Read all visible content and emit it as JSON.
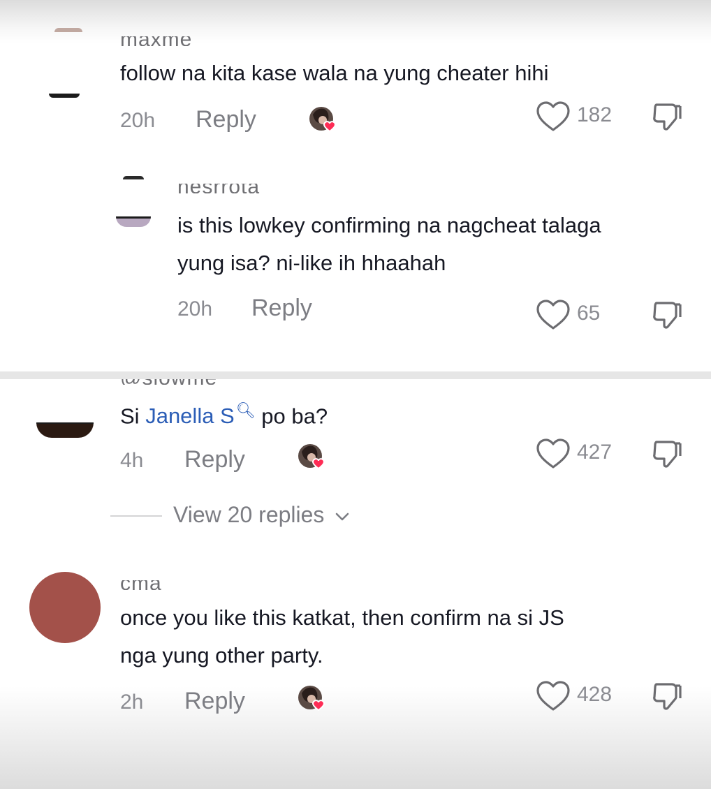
{
  "comments": [
    {
      "username": "maxme",
      "text": "follow na kita kase wala na yung cheater hihi",
      "time": "20h",
      "reply_label": "Reply",
      "likes": "182",
      "liked_by_creator": true
    },
    {
      "username": "nesrrota",
      "text_line1": "is this lowkey confirming na nagcheat talaga",
      "text_line2": "yung isa? ni-like ih hhaahah",
      "time": "20h",
      "reply_label": "Reply",
      "likes": "65",
      "liked_by_creator": false
    },
    {
      "username": "@slowme",
      "text_before": "Si",
      "mention": "Janella S",
      "mention_icon": "search-icon",
      "text_after": "po ba?",
      "time": "4h",
      "reply_label": "Reply",
      "likes": "427",
      "liked_by_creator": true,
      "view_replies_label": "View 20 replies"
    },
    {
      "username": "cma",
      "text_line1": "once you like this katkat, then confirm na si JS",
      "text_line2": "nga yung other party.",
      "time": "2h",
      "reply_label": "Reply",
      "likes": "428",
      "liked_by_creator": true,
      "avatar_color": "#a3514a"
    }
  ],
  "icons": {
    "like": "heart-outline-icon",
    "dislike": "thumbs-down-icon",
    "creator_like": "creator-liked-avatar",
    "expand": "chevron-down-icon"
  }
}
